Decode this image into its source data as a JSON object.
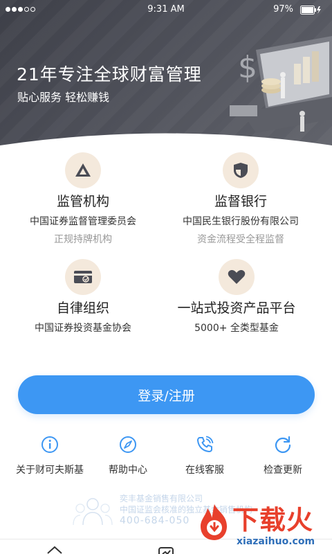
{
  "status_bar": {
    "time": "9:31 AM",
    "battery": "97%"
  },
  "hero": {
    "title": "21年专注全球财富管理",
    "subtitle": "贴心服务 轻松赚钱"
  },
  "features": [
    {
      "icon": "triangle-logo-icon",
      "title": "监管机构",
      "line1": "中国证券监督管理委员会",
      "line2": "正规持牌机构"
    },
    {
      "icon": "shield-icon",
      "title": "监督银行",
      "line1": "中国民生银行股份有限公司",
      "line2": "资金流程受全程监督"
    },
    {
      "icon": "card-icon",
      "title": "自律组织",
      "line1": "中国证券投资基金协会",
      "line2": ""
    },
    {
      "icon": "heart-icon",
      "title": "一站式投资产品平台",
      "line1": "5000+ 全类型基金",
      "line2": ""
    }
  ],
  "login_button": "登录/注册",
  "shortcuts": [
    {
      "icon": "info-icon",
      "label": "关于财可夫斯基"
    },
    {
      "icon": "compass-icon",
      "label": "帮助中心"
    },
    {
      "icon": "phone-icon",
      "label": "在线客服"
    },
    {
      "icon": "refresh-icon",
      "label": "检查更新"
    }
  ],
  "footer": {
    "company": "奕丰基金销售有限公司",
    "note": "中国证监会核准的独立基金销售机构",
    "phone": "400-684-050"
  },
  "watermark": {
    "text": "下载火",
    "url": "xiazaihuo.com"
  },
  "colors": {
    "accent": "#3d97f3",
    "hero_bg": "#4a4c55",
    "icon_bg": "#f4e9dc",
    "icon_fg": "#4a4c55"
  }
}
